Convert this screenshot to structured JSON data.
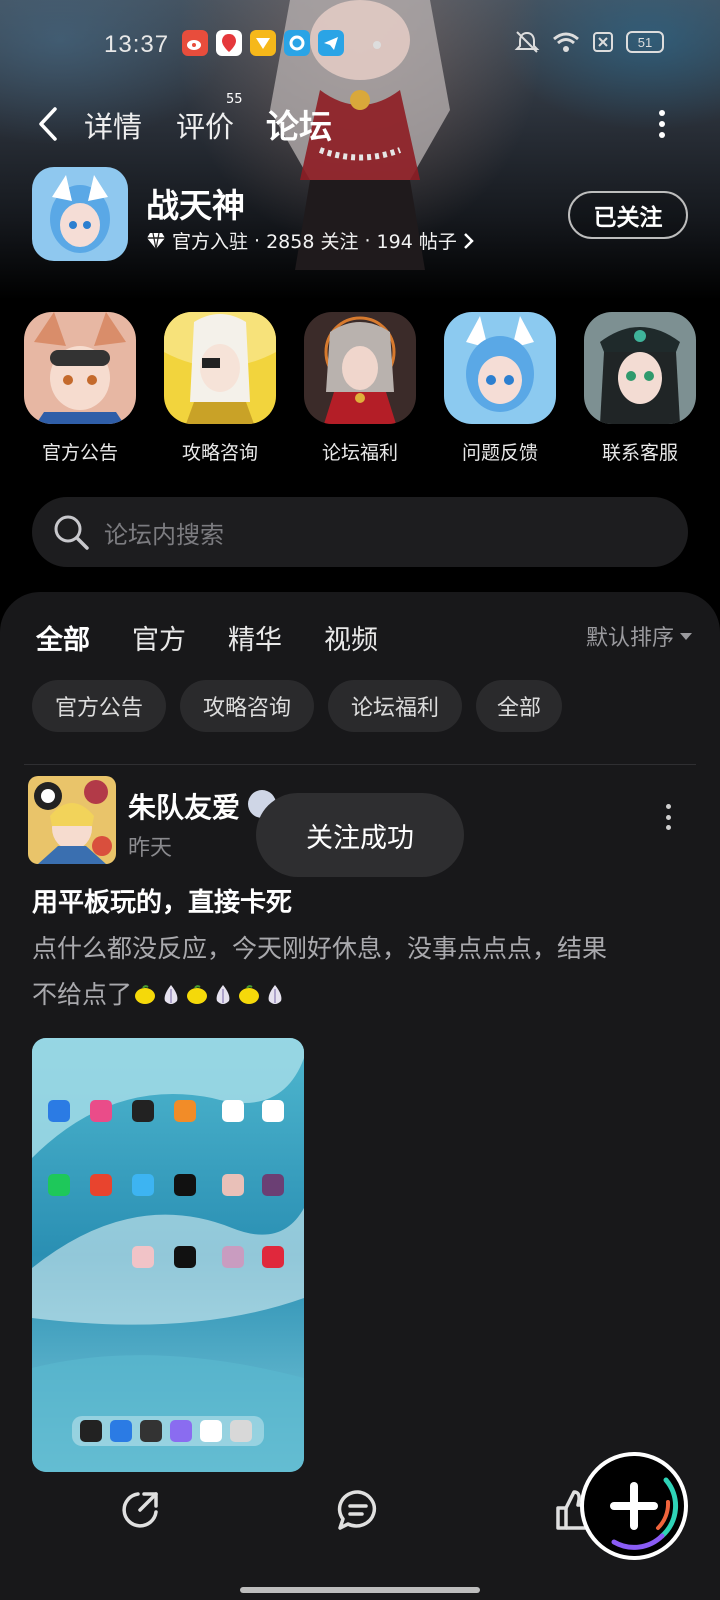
{
  "status_bar": {
    "time": "13:37",
    "battery": "51",
    "notif_icons": [
      "weibo-icon",
      "maps-icon",
      "rewards-icon",
      "browser-icon",
      "telegram-icon"
    ]
  },
  "nav": {
    "tabs": [
      {
        "label": "详情",
        "active": false
      },
      {
        "label": "评价",
        "active": false
      },
      {
        "label": "论坛",
        "active": true
      }
    ],
    "review_count": "55"
  },
  "game": {
    "name": "战天神",
    "meta_official": "官方入驻",
    "meta_followers": "2858 关注",
    "meta_posts": "194 帖子",
    "separator": "·",
    "follow_label": "已关注"
  },
  "quick_links": [
    {
      "label": "官方公告"
    },
    {
      "label": "攻略咨询"
    },
    {
      "label": "论坛福利"
    },
    {
      "label": "问题反馈"
    },
    {
      "label": "联系客服"
    }
  ],
  "search": {
    "placeholder": "论坛内搜索"
  },
  "feed": {
    "tabs": [
      {
        "label": "全部",
        "active": true
      },
      {
        "label": "官方",
        "active": false
      },
      {
        "label": "精华",
        "active": false
      },
      {
        "label": "视频",
        "active": false
      }
    ],
    "sort_label": "默认排序",
    "chips": [
      "官方公告",
      "攻略咨询",
      "论坛福利",
      "全部"
    ]
  },
  "post": {
    "author": "朱队友爱",
    "time": "昨天",
    "title": "用平板玩的，直接卡死",
    "body_line1": "点什么都没反应，今天刚好休息，没事点点点，结果",
    "body_line2": "不给点了"
  },
  "toast": {
    "text": "关注成功"
  },
  "colors": {
    "accent": "#22c7a6",
    "panel_bg": "#18181a",
    "chip_bg": "#2a2a2c",
    "search_bg": "#1d1d1f"
  }
}
